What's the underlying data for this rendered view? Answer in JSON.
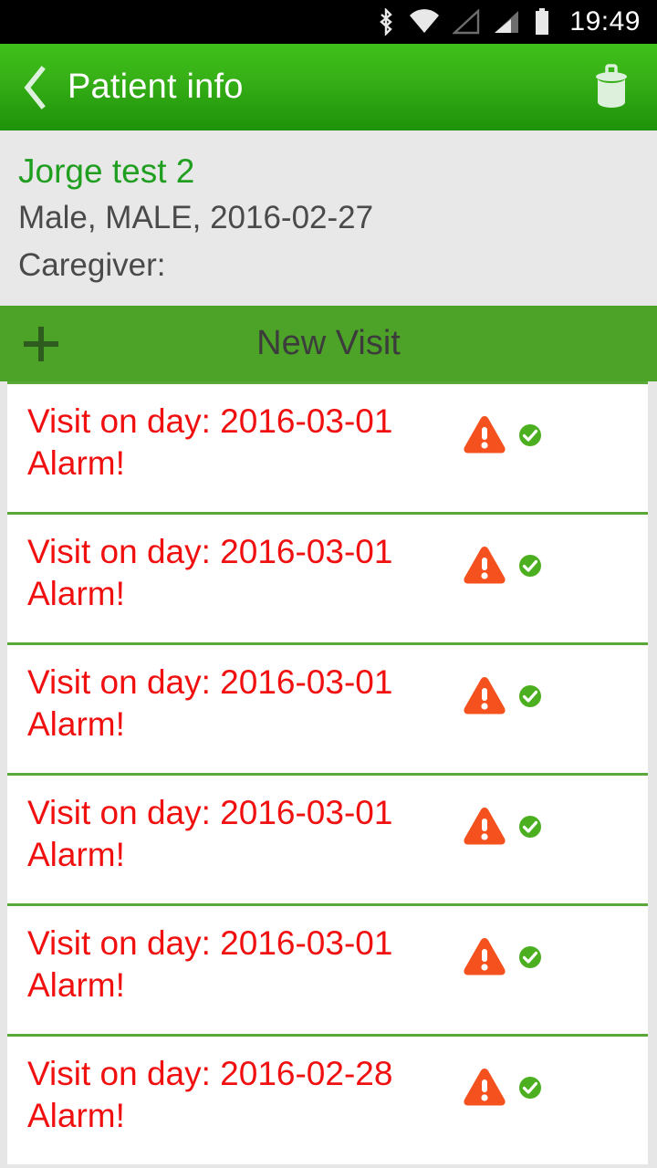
{
  "status_bar": {
    "icons": [
      "bluetooth-icon",
      "wifi-icon",
      "signal-icon-1",
      "signal-icon-2",
      "battery-icon"
    ],
    "time": "19:49"
  },
  "app_bar": {
    "back_label": "back-icon",
    "title": "Patient info",
    "delete_label": "trash-icon"
  },
  "patient": {
    "name": "Jorge test 2",
    "demographics": "Male, MALE, 2016-02-27",
    "caregiver": "Caregiver:"
  },
  "new_visit": {
    "label": "New Visit",
    "plus_icon": "plus-icon"
  },
  "visits": [
    {
      "line1": "Visit on day: 2016-03-01",
      "line2": "Alarm!",
      "warning": "warning-icon",
      "status": "check-icon"
    },
    {
      "line1": "Visit on day: 2016-03-01",
      "line2": "Alarm!",
      "warning": "warning-icon",
      "status": "check-icon"
    },
    {
      "line1": "Visit on day: 2016-03-01",
      "line2": "Alarm!",
      "warning": "warning-icon",
      "status": "check-icon"
    },
    {
      "line1": "Visit on day: 2016-03-01",
      "line2": "Alarm!",
      "warning": "warning-icon",
      "status": "check-icon"
    },
    {
      "line1": "Visit on day: 2016-03-01",
      "line2": "Alarm!",
      "warning": "warning-icon",
      "status": "check-icon"
    },
    {
      "line1": "Visit on day: 2016-02-28",
      "line2": "Alarm!",
      "warning": "warning-icon",
      "status": "check-icon"
    }
  ],
  "colors": {
    "app_bar_green": "#2fa80f",
    "accent_green": "#4ca327",
    "name_green": "#1f9e1f",
    "alarm_red": "#f01010",
    "warning_orange": "#f4511e",
    "status_green": "#4caf20",
    "header_gray": "#e8e8e8",
    "status_bar_black": "#000000"
  }
}
